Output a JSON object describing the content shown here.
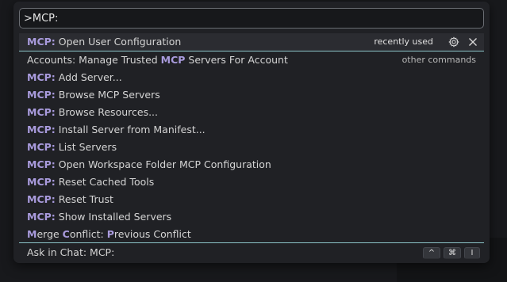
{
  "search": {
    "value": ">MCP:"
  },
  "items": [
    {
      "prefix": "MCP:",
      "label": " Open User Configuration",
      "meta": "recently used",
      "selected": true
    },
    {
      "prefix": "",
      "label": "Accounts: Manage Trusted ",
      "hl": "MCP",
      "suffix": " Servers For Account",
      "meta": "other commands"
    },
    {
      "prefix": "MCP:",
      "label": " Add Server..."
    },
    {
      "prefix": "MCP:",
      "label": " Browse MCP Servers"
    },
    {
      "prefix": "MCP:",
      "label": " Browse Resources..."
    },
    {
      "prefix": "MCP:",
      "label": " Install Server from Manifest..."
    },
    {
      "prefix": "MCP:",
      "label": " List Servers"
    },
    {
      "prefix": "MCP:",
      "label": " Open Workspace Folder MCP Configuration"
    },
    {
      "prefix": "MCP:",
      "label": " Reset Cached Tools"
    },
    {
      "prefix": "MCP:",
      "label": " Reset Trust"
    },
    {
      "prefix": "MCP:",
      "label": " Show Installed Servers"
    }
  ],
  "merge_item": {
    "m": "M",
    "a": "erge ",
    "c": "C",
    "b": "onflict: ",
    "p": "P",
    "rest": "revious Conflict"
  },
  "icons": {
    "gear": "gear-icon",
    "close": "close-icon"
  },
  "footer": {
    "label": "Ask in Chat: MCP:",
    "keys": [
      "^",
      "⌘",
      "I"
    ]
  },
  "colors": {
    "highlight": "#a99bdd",
    "focus_border": "#8cc4c9",
    "palette_bg": "#202125"
  }
}
